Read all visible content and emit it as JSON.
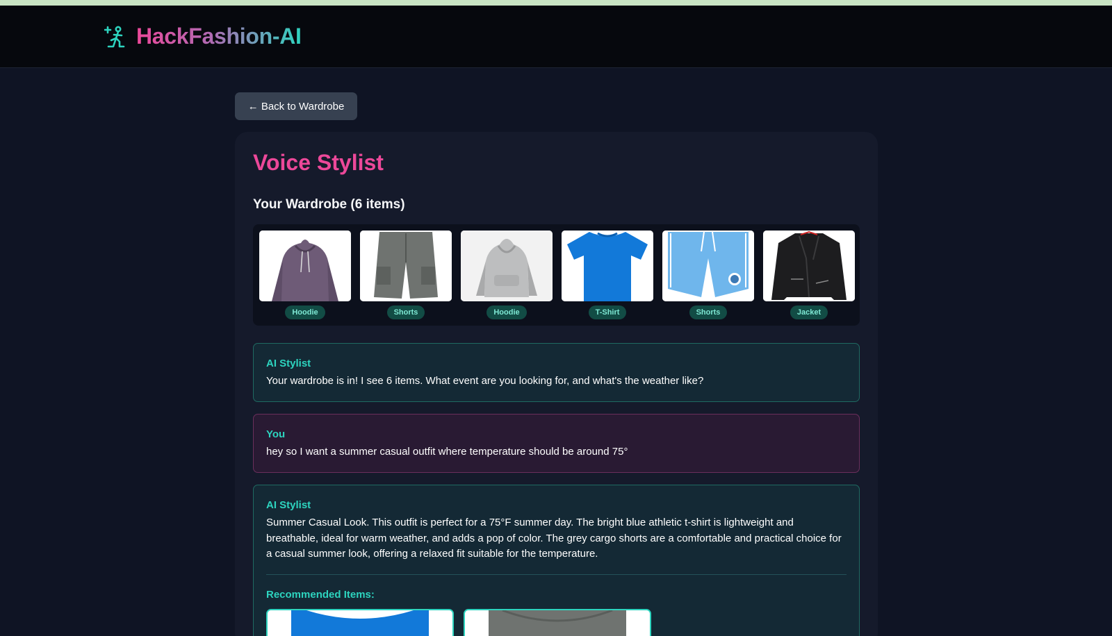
{
  "app": {
    "brand_name": "HackFashion-AI",
    "logo_icon": "figure-sparkle-icon",
    "colors": {
      "accent_pink": "#ec4899",
      "accent_teal": "#2dd4bf",
      "background": "#0f1424",
      "card": "#151a2b"
    }
  },
  "nav": {
    "back_label": "← Back to Wardrobe"
  },
  "page": {
    "title": "Voice Stylist",
    "wardrobe_heading": "Your Wardrobe (6 items)"
  },
  "wardrobe": {
    "items": [
      {
        "label": "Hoodie",
        "icon": "purple-hoodie-icon"
      },
      {
        "label": "Shorts",
        "icon": "grey-cargo-shorts-icon"
      },
      {
        "label": "Hoodie",
        "icon": "grey-hoodie-icon"
      },
      {
        "label": "T-Shirt",
        "icon": "blue-tshirt-icon"
      },
      {
        "label": "Shorts",
        "icon": "blue-shorts-icon"
      },
      {
        "label": "Jacket",
        "icon": "black-leather-jacket-icon"
      }
    ]
  },
  "chat": {
    "messages": [
      {
        "sender": "AI Stylist",
        "text": "Your wardrobe is in! I see 6 items. What event are you looking for, and what's the weather like?"
      },
      {
        "sender": "You",
        "text": "hey so I want a summer casual outfit where temperature should be around 75°"
      },
      {
        "sender": "AI Stylist",
        "text": "Summer Casual Look. This outfit is perfect for a 75°F summer day. The bright blue athletic t-shirt is lightweight and breathable, ideal for warm weather, and adds a pop of color. The grey cargo shorts are a comfortable and practical choice for a casual summer look, offering a relaxed fit suitable for the temperature."
      }
    ],
    "recommended_heading": "Recommended Items:",
    "recommended_items": [
      {
        "icon": "blue-tshirt-icon"
      },
      {
        "icon": "grey-cargo-shorts-icon"
      }
    ]
  }
}
